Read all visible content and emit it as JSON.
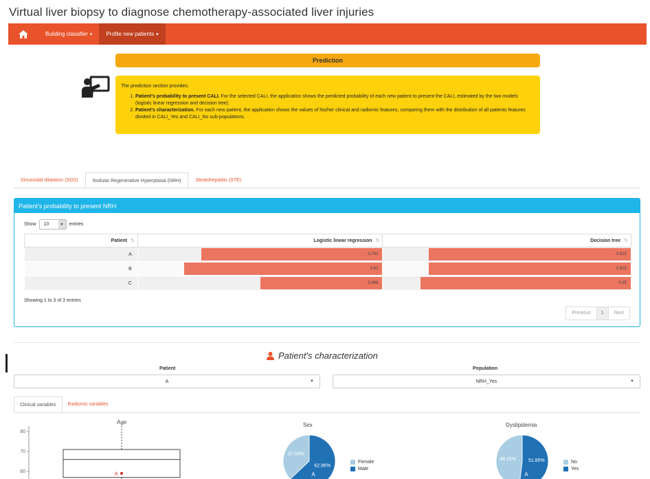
{
  "app": {
    "title": "Virtual liver biopsy to diagnose chemotherapy-associated liver injuries"
  },
  "navbar": {
    "items": [
      {
        "label": "Building classifier"
      },
      {
        "label": "Profile new patients"
      }
    ]
  },
  "prediction": {
    "header": "Prediction",
    "intro": "The prediction section provides:",
    "item1_title": "Patient's probability to present CALI.",
    "item1_text": " For the selected CALI, the application shows the predicted probability of each new patient to present the CALI, estimated by the two models (logistic linear regression and decision tree).",
    "item2_title": "Patient's characterization.",
    "item2_text": " For each new patient, the application shows the values of his/her clinical and radiomic features, comparing them with the distribution of all patients features divided in CALI_Yes and CALI_No sub-populations."
  },
  "cali_tabs": [
    {
      "label": "Sinusoidal dilatation (SOS)"
    },
    {
      "label": "Nodular Regenerative Hyperplasia (NRH)"
    },
    {
      "label": "Steatohepatitis (STE)"
    }
  ],
  "probability_panel": {
    "title": "Patient's probability to present NRH",
    "show_label": "Show",
    "entries_value": "10",
    "entries_label": "entries",
    "columns": [
      "Patient",
      "Logistic linear regression",
      "Decision tree"
    ],
    "rows": [
      {
        "patient": "A",
        "lr": "0.742",
        "dt": "0.815",
        "lr_frac": 0.742,
        "dt_frac": 0.815
      },
      {
        "patient": "B",
        "lr": "0.81",
        "dt": "0.815",
        "lr_frac": 0.81,
        "dt_frac": 0.815
      },
      {
        "patient": "C",
        "lr": "0.498",
        "dt": "0.85",
        "lr_frac": 0.498,
        "dt_frac": 0.85
      }
    ],
    "showing_text": "Showing 1 to 3 of 3 entries",
    "pager": {
      "previous": "Previous",
      "page": "1",
      "next": "Next"
    }
  },
  "characterization": {
    "title": "Patient's characterization",
    "patient_label": "Patient",
    "patient_value": "A",
    "population_label": "Population",
    "population_value": "NRH_Yes",
    "tabs": [
      {
        "label": "Clinical variables"
      },
      {
        "label": "Radiomic variables"
      }
    ]
  },
  "chart_data": [
    {
      "type": "box",
      "title": "Age",
      "yticks": [
        "80",
        "70",
        "60"
      ],
      "box": {
        "q1": 57,
        "median": 66,
        "q3": 71
      },
      "point": {
        "label": "A",
        "value": 59
      }
    },
    {
      "type": "pie",
      "title": "Sex",
      "labels": [
        "Female",
        "Male"
      ],
      "slice_labels": [
        "37.04%",
        "62.96%"
      ],
      "values": [
        37.04,
        62.96
      ],
      "marker": "A",
      "colors": [
        "#a9cde3",
        "#2171b5"
      ]
    },
    {
      "type": "pie",
      "title": "Dyslipidemia",
      "labels": [
        "No",
        "Yes"
      ],
      "slice_labels": [
        "48.15%",
        "51.85%"
      ],
      "values": [
        48.15,
        51.85
      ],
      "marker": "A",
      "colors": [
        "#a9cde3",
        "#2171b5"
      ]
    }
  ]
}
